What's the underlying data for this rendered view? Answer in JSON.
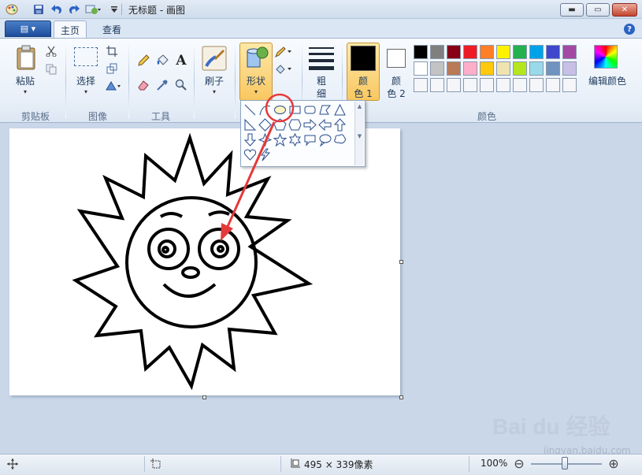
{
  "window": {
    "title": "无标题 - 画图",
    "min_glyph": "▬",
    "max_glyph": "▭",
    "close_glyph": "✕"
  },
  "ribbon_tabs": {
    "file_glyph": "▤ ▾",
    "home": "主页",
    "view": "查看"
  },
  "clipboard": {
    "paste": "粘贴",
    "group": "剪贴板"
  },
  "image": {
    "select": "选择",
    "group": "图像"
  },
  "tools": {
    "group": "工具"
  },
  "brushes": {
    "label": "刷子"
  },
  "shapes": {
    "label": "形状"
  },
  "size": {
    "label_line1": "粗",
    "label_line2": "细"
  },
  "color1": {
    "line1": "颜",
    "line2": "色 1"
  },
  "color2": {
    "line1": "颜",
    "line2": "色 2"
  },
  "colors": {
    "group": "颜色",
    "edit": "编辑颜色",
    "row1": [
      "#000000",
      "#7f7f7f",
      "#880015",
      "#ed1c24",
      "#ff7f27",
      "#fff200",
      "#22b14c",
      "#00a2e8",
      "#3f48cc",
      "#a349a4"
    ],
    "row2": [
      "#ffffff",
      "#c3c3c3",
      "#b97a57",
      "#ffaec9",
      "#ffc90e",
      "#efe4b0",
      "#b5e61d",
      "#99d9ea",
      "#7092be",
      "#c8bfe7"
    ],
    "color1_value": "#000000",
    "color2_value": "#ffffff"
  },
  "annotation_color": "#e53a3a",
  "statusbar": {
    "canvas_size": "495 × 339像素",
    "zoom": "100%",
    "zoom_out": "⊖",
    "zoom_in": "⊕"
  },
  "watermark": {
    "brand": "Bai du 经验",
    "url": "jingyan.baidu.com"
  }
}
